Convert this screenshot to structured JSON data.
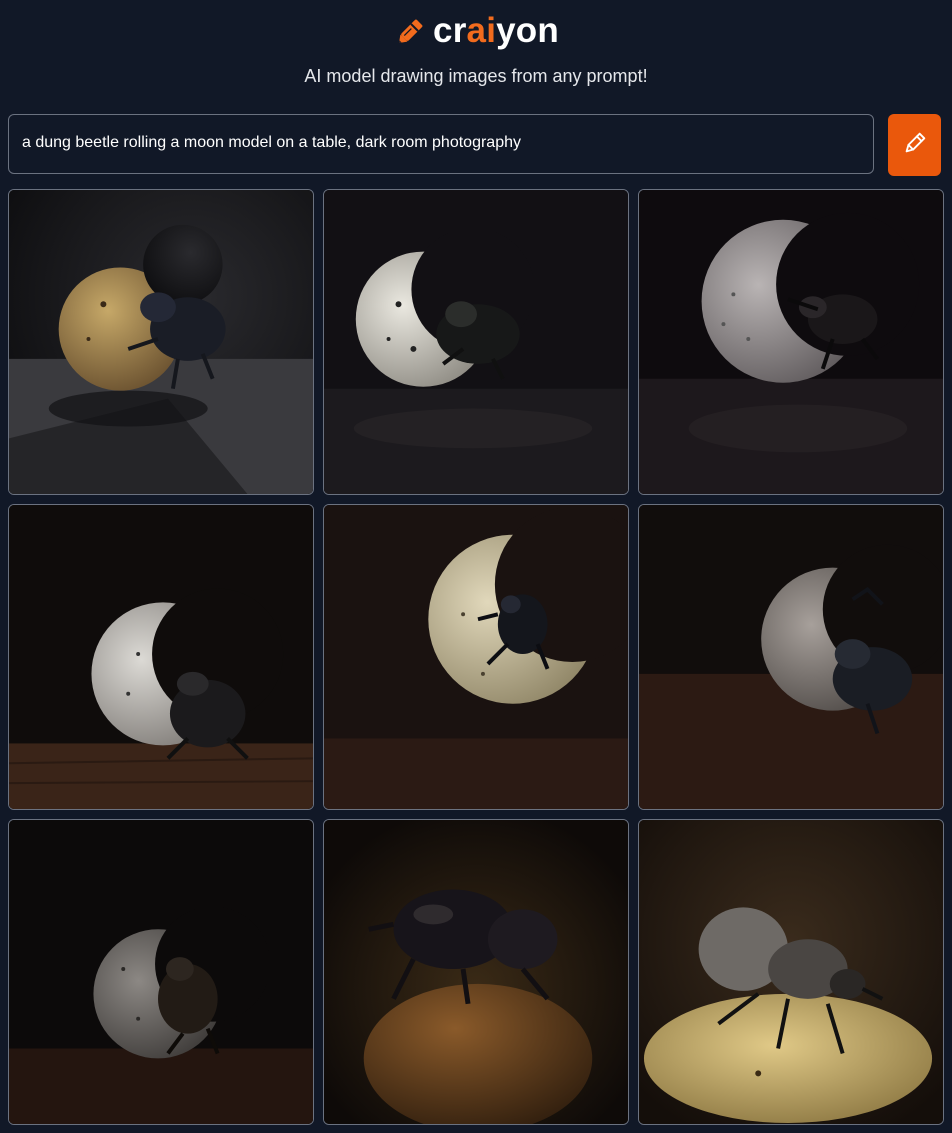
{
  "header": {
    "logo_prefix": "cr",
    "logo_accent": "ai",
    "logo_suffix": "yon",
    "logo_icon": "pencil-icon",
    "tagline": "AI model drawing images from any prompt!"
  },
  "prompt": {
    "value": "a dung beetle rolling a moon model on a table, dark room photography"
  },
  "draw_button": {
    "icon": "pencil-icon",
    "color": "#ea580c"
  },
  "colors": {
    "background": "#111827",
    "accent": "#f26b1d",
    "border": "#6b7280"
  },
  "results": {
    "count": 9,
    "images": [
      {
        "subject": "golden moon with beetle"
      },
      {
        "subject": "white crescent moon with beetle"
      },
      {
        "subject": "grey crescent moon with beetle"
      },
      {
        "subject": "white crescent moon with beetle on wood"
      },
      {
        "subject": "cream crescent moon with beetle"
      },
      {
        "subject": "grey crescent moon with beetle"
      },
      {
        "subject": "grey crescent moon with beetle"
      },
      {
        "subject": "beetle on dung ball"
      },
      {
        "subject": "beetle on golden base"
      }
    ]
  }
}
